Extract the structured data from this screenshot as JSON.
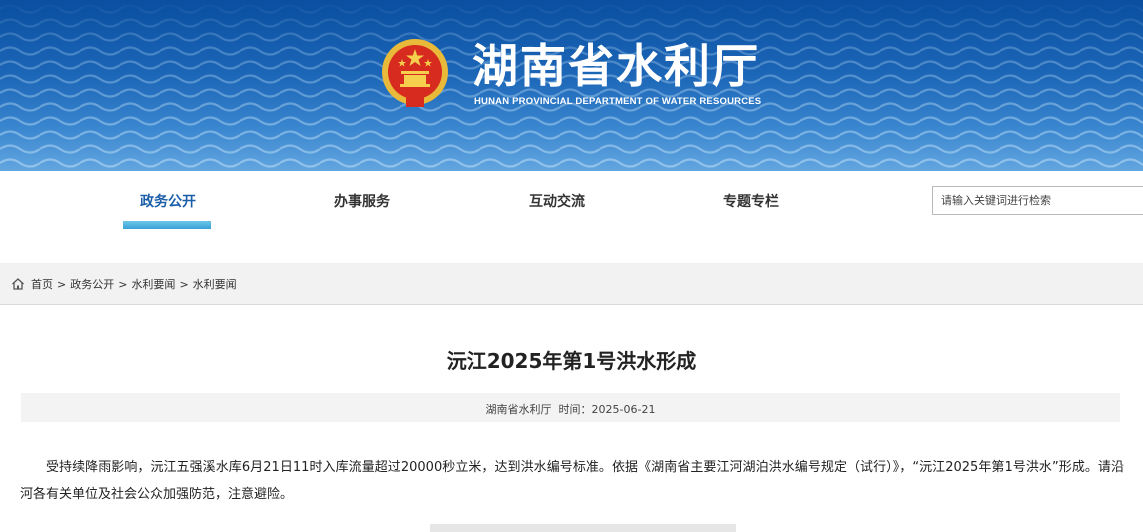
{
  "banner": {
    "title": "湖南省水利厅",
    "subtitle": "HUNAN PROVINCIAL DEPARTMENT OF WATER RESOURCES",
    "emblem_icon": "national-emblem-icon",
    "colors": {
      "banner_top": "#0a4fa0",
      "banner_bottom": "#62a6e0"
    }
  },
  "nav": {
    "items": [
      {
        "label": "政务公开",
        "active": true
      },
      {
        "label": "办事服务",
        "active": false
      },
      {
        "label": "互动交流",
        "active": false
      },
      {
        "label": "专题专栏",
        "active": false
      }
    ],
    "active_color": "#1a5ea8",
    "search": {
      "placeholder": "请输入关键词进行检索"
    }
  },
  "breadcrumb": {
    "home_icon": "home-icon",
    "items": [
      "首页",
      "政务公开",
      "水利要闻",
      "水利要闻"
    ],
    "separator": ">"
  },
  "article": {
    "title": "沅江2025年第1号洪水形成",
    "meta": "湖南省水利厅  时间：2025-06-21",
    "body": "受持续降雨影响，沅江五强溪水库6月21日11时入库流量超过20000秒立米，达到洪水编号标准。依据《湖南省主要江河湖泊洪水编号规定（试行）》，“沅江2025年第1号洪水”形成。请沿河各有关单位及社会公众加强防范，注意避险。"
  }
}
